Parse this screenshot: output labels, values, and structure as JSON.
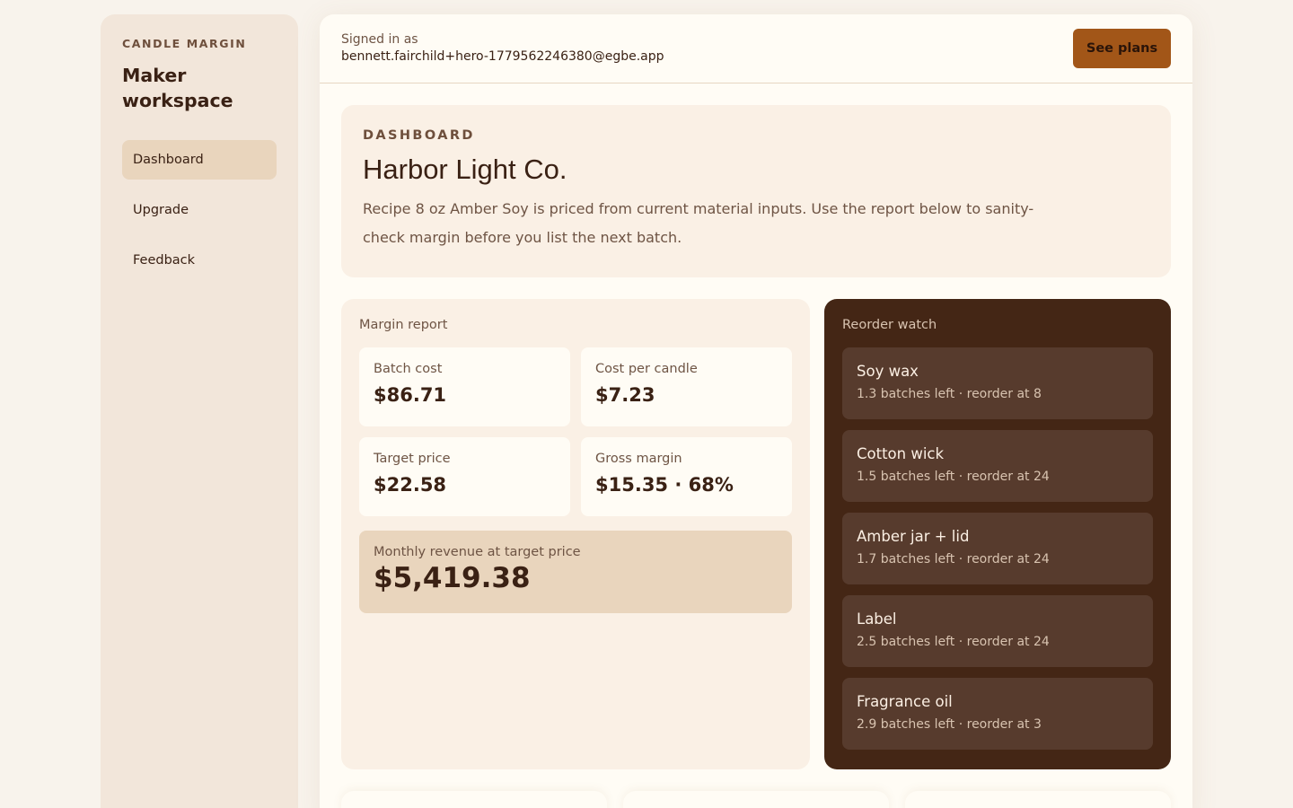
{
  "sidebar": {
    "brand": "CANDLE MARGIN",
    "workspace_title": "Maker workspace",
    "nav": [
      {
        "label": "Dashboard",
        "active": true
      },
      {
        "label": "Upgrade",
        "active": false
      },
      {
        "label": "Feedback",
        "active": false
      }
    ]
  },
  "topbar": {
    "signed_in_label": "Signed in as",
    "email": "bennett.fairchild+hero-1779562246380@egbe.app",
    "cta_label": "See plans"
  },
  "hero": {
    "eyebrow": "DASHBOARD",
    "title": "Harbor Light Co.",
    "description": "Recipe 8 oz Amber Soy is priced from current material inputs. Use the report below to sanity-check margin before you list the next batch."
  },
  "margin_report": {
    "title": "Margin report",
    "stats": [
      {
        "label": "Batch cost",
        "value": "$86.71"
      },
      {
        "label": "Cost per candle",
        "value": "$7.23"
      },
      {
        "label": "Target price",
        "value": "$22.58"
      },
      {
        "label": "Gross margin",
        "value": "$15.35 · 68%"
      }
    ],
    "revenue": {
      "label": "Monthly revenue at target price",
      "value": "$5,419.38"
    }
  },
  "reorder_watch": {
    "title": "Reorder watch",
    "items": [
      {
        "name": "Soy wax",
        "detail": "1.3 batches left · reorder at 8"
      },
      {
        "name": "Cotton wick",
        "detail": "1.5 batches left · reorder at 24"
      },
      {
        "name": "Amber jar + lid",
        "detail": "1.7 batches left · reorder at 24"
      },
      {
        "name": "Label",
        "detail": "2.5 batches left · reorder at 24"
      },
      {
        "name": "Fragrance oil",
        "detail": "2.9 batches left · reorder at 3"
      }
    ]
  },
  "colors": {
    "accent": "#a25618",
    "dark_panel": "#442615",
    "active_nav": "#e9d5bd"
  }
}
